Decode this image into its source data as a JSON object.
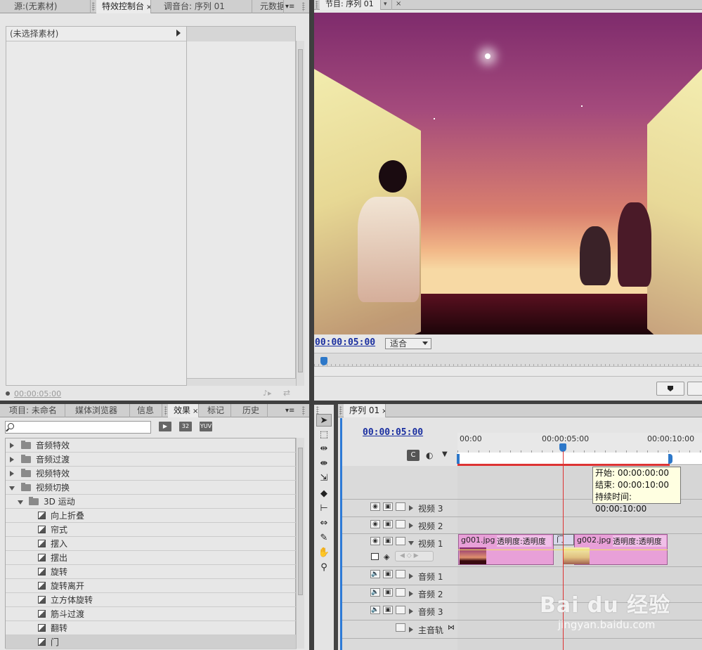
{
  "source_tabs": [
    {
      "label": "源:(无素材)"
    },
    {
      "label": "特效控制台",
      "active": true
    },
    {
      "label": "调音台: 序列 01"
    },
    {
      "label": "元数据"
    }
  ],
  "effect_controls": {
    "header": "(未选择素材)",
    "timecode": "00:00:05:00"
  },
  "program": {
    "tab": "节目: 序列 01",
    "timecode": "00:00:05:00",
    "fit": "适合"
  },
  "project_tabs": [
    {
      "label": "项目: 未命名"
    },
    {
      "label": "媒体浏览器"
    },
    {
      "label": "信息"
    },
    {
      "label": "效果",
      "active": true
    },
    {
      "label": "标记"
    },
    {
      "label": "历史"
    }
  ],
  "effects": {
    "search_value": "",
    "buttons": [
      "32",
      "YUV"
    ],
    "items": [
      {
        "label": "音频特效",
        "level": 0,
        "type": "folder",
        "open": false
      },
      {
        "label": "音频过渡",
        "level": 0,
        "type": "folder",
        "open": false
      },
      {
        "label": "视频特效",
        "level": 0,
        "type": "folder",
        "open": false
      },
      {
        "label": "视频切换",
        "level": 0,
        "type": "folder",
        "open": true
      },
      {
        "label": "3D 运动",
        "level": 1,
        "type": "folder",
        "open": true
      },
      {
        "label": "向上折叠",
        "level": 2,
        "type": "fx"
      },
      {
        "label": "帘式",
        "level": 2,
        "type": "fx"
      },
      {
        "label": "摆入",
        "level": 2,
        "type": "fx"
      },
      {
        "label": "摆出",
        "level": 2,
        "type": "fx"
      },
      {
        "label": "旋转",
        "level": 2,
        "type": "fx"
      },
      {
        "label": "旋转离开",
        "level": 2,
        "type": "fx"
      },
      {
        "label": "立方体旋转",
        "level": 2,
        "type": "fx"
      },
      {
        "label": "筋斗过渡",
        "level": 2,
        "type": "fx"
      },
      {
        "label": "翻转",
        "level": 2,
        "type": "fx"
      },
      {
        "label": "门",
        "level": 2,
        "type": "fx",
        "selected": true
      }
    ]
  },
  "timeline": {
    "tab": "序列 01",
    "timecode": "00:00:05:00",
    "ruler": [
      "00:00",
      "00:00:05:00",
      "00:00:10:00"
    ],
    "tracks": [
      {
        "label": "视频 3"
      },
      {
        "label": "视频 2"
      },
      {
        "label": "视频 1"
      },
      {
        "label": "音频 1"
      },
      {
        "label": "音频 2"
      },
      {
        "label": "音频 3"
      },
      {
        "label": "主音轨"
      }
    ],
    "clips": [
      {
        "name": "g001.jpg",
        "opacity": "透明度:透明度"
      },
      {
        "name": "g002.jpg",
        "opacity": "透明度:透明度"
      }
    ],
    "transition_label": "门",
    "tooltip": {
      "start": "开始: 00:00:00:00",
      "end": "结束: 00:00:10:00",
      "duration": "持续时间: 00:00:10:00"
    }
  },
  "watermark": {
    "brand": "Bai du 经验",
    "url": "jingyan.baidu.com"
  }
}
